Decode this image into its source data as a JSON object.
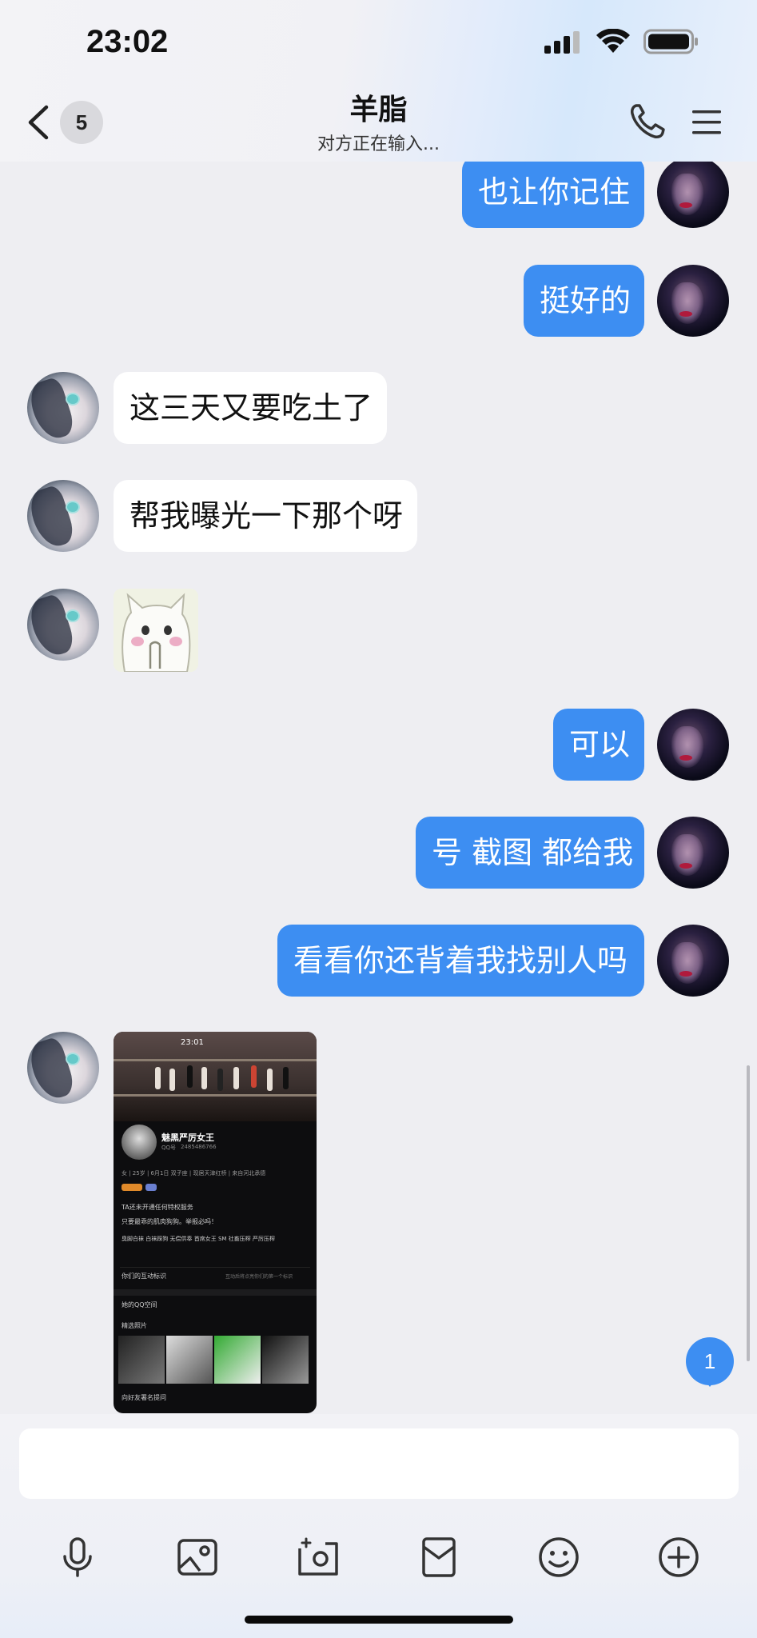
{
  "status_bar": {
    "time": "23:02"
  },
  "header": {
    "unread_count": "5",
    "title": "羊脂",
    "subtitle": "对方正在输入..."
  },
  "messages": [
    {
      "sender": "self",
      "text": "也让你记住"
    },
    {
      "sender": "self",
      "text": "挺好的"
    },
    {
      "sender": "other",
      "text": "这三天又要吃土了"
    },
    {
      "sender": "other",
      "text": "帮我曝光一下那个呀"
    },
    {
      "sender": "other",
      "type": "sticker"
    },
    {
      "sender": "self",
      "text": "可以"
    },
    {
      "sender": "self",
      "text": "号 截图 都给我"
    },
    {
      "sender": "self",
      "text": "看看你还背着我找别人吗"
    },
    {
      "sender": "other",
      "type": "image"
    }
  ],
  "shared_screenshot": {
    "time": "23:01",
    "nickname": "魅黑严厉女王",
    "qq_label": "QQ号",
    "qq_id": "2485486766",
    "info_line": "女 | 25岁 | 6月1日 双子座 | 现居天津红桥 | 来自河北承德",
    "line_vip": "TA还未开通任何特权服务",
    "line_bio": "只要最乖的肌肉狗狗。举报必吗！",
    "tags": [
      "臭脚白袜",
      "白袜踩狗",
      "无偿供奉",
      "首席女王",
      "SM",
      "社畜压榨",
      "严厉压榨"
    ],
    "interaction_label": "你们的互动标识",
    "interaction_hint": "互动后将点亮你们的第一个标识",
    "qzone_label": "她的QQ空间",
    "photos_label": "精选照片",
    "friends_label": "向好友署名提问"
  },
  "new_message_count": "1",
  "composer": {
    "placeholder": ""
  },
  "toolbar": [
    "microphone-icon",
    "image-icon",
    "camera-icon",
    "red-packet-icon",
    "emoji-icon",
    "plus-icon"
  ],
  "colors": {
    "self_bubble": "#3d8ef2",
    "other_bubble": "#ffffff",
    "background": "#eeeef2"
  }
}
